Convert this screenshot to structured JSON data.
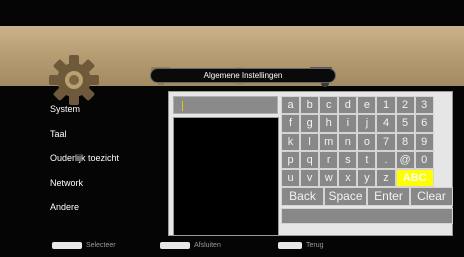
{
  "header": {
    "title": "Algemene Instellingen"
  },
  "menu": {
    "items": [
      {
        "label": "System"
      },
      {
        "label": "Taal"
      },
      {
        "label": "Ouderlijk toezicht"
      },
      {
        "label": "Network"
      },
      {
        "label": "Andere"
      }
    ]
  },
  "keyboard": {
    "input_value": "",
    "rows": [
      [
        "a",
        "b",
        "c",
        "d",
        "e",
        "1",
        "2",
        "3"
      ],
      [
        "f",
        "g",
        "h",
        "i",
        "j",
        "4",
        "5",
        "6"
      ],
      [
        "k",
        "l",
        "m",
        "n",
        "o",
        "7",
        "8",
        "9"
      ],
      [
        "p",
        "q",
        "r",
        "s",
        "t",
        ".",
        "@",
        "0"
      ],
      [
        "u",
        "v",
        "w",
        "x",
        "y",
        "z",
        "ABC"
      ]
    ],
    "actions": [
      "Back",
      "Space",
      "Enter",
      "Clear"
    ],
    "selected": "ABC"
  },
  "footer": {
    "select_label": "Selecteer",
    "cancel_label": "Afsluiten",
    "back_label": "Terug"
  },
  "colors": {
    "banner": "#b79c72",
    "highlight": "#ffff00",
    "key": "#888888"
  },
  "icons": [
    "gear-icon",
    "tv-icon",
    "globe-icon",
    "tools-icon",
    "navigate-keys-icon"
  ]
}
